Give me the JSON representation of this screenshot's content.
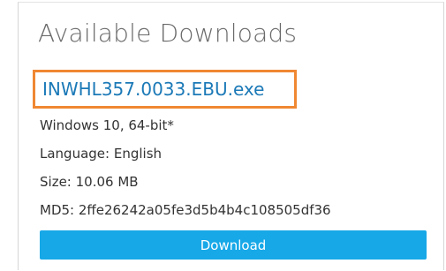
{
  "section": {
    "title": "Available Downloads"
  },
  "file": {
    "name": "INWHL357.0033.EBU.exe",
    "os": "Windows 10, 64-bit*",
    "language": "Language: English",
    "size": "Size: 10.06 MB",
    "md5": "MD5: 2ffe26242a05fe3d5b4b4c108505df36"
  },
  "actions": {
    "download_label": "Download"
  },
  "colors": {
    "link": "#1b79b7",
    "highlight_border": "#f08732",
    "button": "#17a8e8",
    "title_text": "#6a6a6a"
  }
}
